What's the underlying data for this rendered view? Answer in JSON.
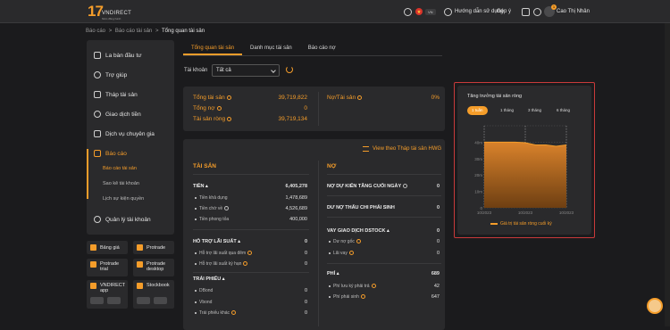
{
  "header": {
    "logo_mark": "17",
    "logo_text": "VNDIRECT",
    "logo_sub": "Năm đồng hành",
    "lang": "VN",
    "guide": "Hướng dẫn sử dụng",
    "feedback": "Góp ý",
    "notif_count": "1",
    "user": "Cao Thị Nhân"
  },
  "breadcrumb": {
    "b1": "Báo cáo",
    "b2": "Báo cáo tài sản",
    "b3": "Tổng quan tài sản",
    "sep": ">"
  },
  "sidebar": {
    "items": [
      "La bàn đầu tư",
      "Trợ giúp",
      "Tháp tài sản",
      "Giao dịch tiền",
      "Dịch vụ chuyên gia",
      "Báo cáo"
    ],
    "sub": [
      "Báo cáo tài sản",
      "Sao kê tài khoản",
      "Lịch sự kiện quyền"
    ],
    "last": "Quản lý tài khoản"
  },
  "apps": {
    "banggia": "Bảng giá",
    "protrade": "Protrade",
    "protrade_trial_1": "Protrade",
    "protrade_trial_2": "trial",
    "protrade_desktop_1": "Protrade",
    "protrade_desktop_2": "desktop",
    "vnd_app_1": "VNDIRECT",
    "vnd_app_2": "app",
    "stockbook": "Stockbook"
  },
  "tabs": [
    "Tổng quan tài sản",
    "Danh mục tài sản",
    "Báo cáo nợ"
  ],
  "account": {
    "label": "Tài khoản",
    "value": "Tất cả"
  },
  "summary": {
    "total_assets_label": "Tổng tài sản",
    "total_assets": "39,719,822",
    "total_debt_label": "Tổng nợ",
    "total_debt": "0",
    "net_assets_label": "Tài sản ròng",
    "net_assets": "39,719,134",
    "ratio_label": "Nợ/Tài sản",
    "ratio": "0%"
  },
  "tower_link": "View theo Tháp tài sản HWG",
  "assets": {
    "title": "TÀI SẢN",
    "cash_label": "TIỀN",
    "cash": "6,405,278",
    "cash_rows": [
      {
        "label": "Tiền khả dụng",
        "value": "1,478,689"
      },
      {
        "label": "Tiền chờ về",
        "value": "4,526,689"
      },
      {
        "label": "Tiền phong tỏa",
        "value": "400,000"
      }
    ],
    "interest_label": "HỖ TRỢ LÃI SUẤT",
    "interest": "0",
    "interest_rows": [
      {
        "label": "Hỗ trợ lãi suất qua đêm",
        "value": "0"
      },
      {
        "label": "Hỗ trợ lãi suất kỳ hạn",
        "value": "0"
      }
    ],
    "bond_label": "TRÁI PHIẾU",
    "bond_rows": [
      {
        "label": "DBond",
        "value": "0"
      },
      {
        "label": "Vbond",
        "value": "0"
      },
      {
        "label": "Trái phiếu khác",
        "value": "0"
      }
    ]
  },
  "debt": {
    "title": "NỢ",
    "r1_label": "NỢ DỰ KIẾN TĂNG CUỐI NGÀY",
    "r1": "0",
    "r2_label": "DƯ NỢ THẤU CHI PHÁI SINH",
    "r2": "0",
    "r3_label": "VAY GIAO DỊCH DSTOCK",
    "r3": "0",
    "r3_rows": [
      {
        "label": "Dư nợ gốc",
        "value": "0"
      },
      {
        "label": "Lãi vay",
        "value": "0"
      }
    ],
    "fee_label": "PHÍ",
    "fee": "689",
    "fee_rows": [
      {
        "label": "Phí lưu ký phải trả",
        "value": "42"
      },
      {
        "label": "Phí phái sinh",
        "value": "647"
      }
    ]
  },
  "growth": {
    "title": "Tăng trưởng tài sản ròng",
    "periods": [
      "1 tuần",
      "1 tháng",
      "3 tháng",
      "6 tháng"
    ],
    "legend": "Giá trị tài sản ròng cuối kỳ"
  },
  "chart_data": {
    "type": "area",
    "x": [
      "10/2023",
      "10/2023",
      "10/2023"
    ],
    "yticks": [
      "",
      "40m",
      "30m",
      "20m",
      "10m",
      "0"
    ],
    "ylim": [
      0,
      50
    ],
    "series": [
      {
        "values": [
          40,
          40,
          40,
          40,
          39.7,
          38.3,
          38.3,
          37.5,
          38.3
        ]
      }
    ],
    "colors": {
      "fill_top": "#d9822b",
      "fill_bottom": "#6e3f12",
      "line": "#f59d2a"
    },
    "grid": true
  }
}
